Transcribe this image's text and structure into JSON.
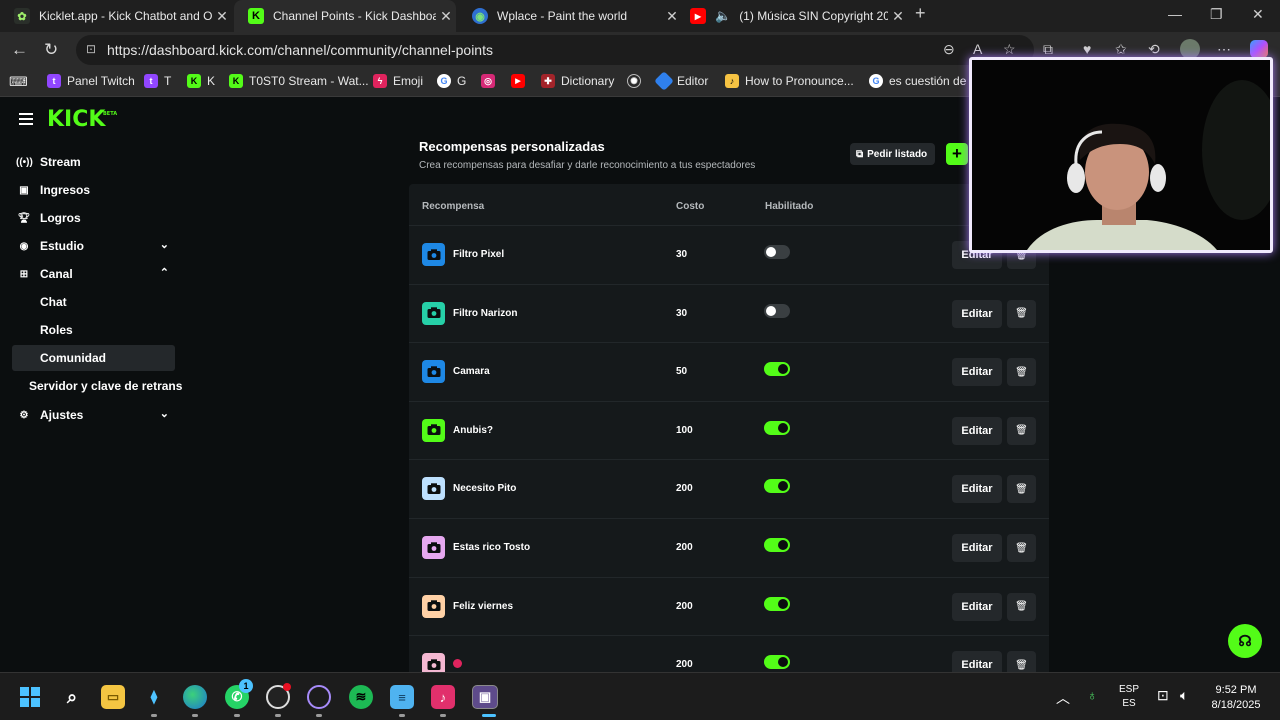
{
  "browser": {
    "tabs": [
      {
        "title": "Kicklet.app - Kick Chatbot and Ov",
        "favicon": "kicklet-icon",
        "active": false
      },
      {
        "title": "Channel Points - Kick Dashboard",
        "favicon": "kick-icon",
        "active": true
      },
      {
        "title": "Wplace - Paint the world",
        "favicon": "globe-icon",
        "active": false
      },
      {
        "title": "(1) Música SIN Copyright 20",
        "favicon": "youtube-icon",
        "active": false
      }
    ],
    "url": "https://dashboard.kick.com/channel/community/channel-points",
    "bookmarks": [
      {
        "label": "Panel Twitch",
        "icon": "twitch-icon"
      },
      {
        "label": "T",
        "icon": "twitch-icon"
      },
      {
        "label": "K",
        "icon": "kick-icon"
      },
      {
        "label": "T0ST0 Stream - Wat...",
        "icon": "kick-icon"
      },
      {
        "label": "Emoji",
        "icon": "emoji-icon"
      },
      {
        "label": "G",
        "icon": "google-icon"
      },
      {
        "label": "",
        "icon": "instagram-icon"
      },
      {
        "label": "",
        "icon": "youtube-icon"
      },
      {
        "label": "Dictionary",
        "icon": "dictionary-icon"
      },
      {
        "label": "",
        "icon": "chatgpt-icon"
      },
      {
        "label": "Editor",
        "icon": "editor-icon"
      },
      {
        "label": "How to Pronounce...",
        "icon": "pronounce-icon"
      },
      {
        "label": "es cuestión de t",
        "icon": "google-icon"
      }
    ]
  },
  "sidebar": {
    "logo": "KICK",
    "logo_badge": "BETA",
    "items": [
      {
        "label": "Stream",
        "icon": "stream-icon"
      },
      {
        "label": "Ingresos",
        "icon": "wallet-icon"
      },
      {
        "label": "Logros",
        "icon": "trophy-icon"
      },
      {
        "label": "Estudio",
        "icon": "studio-icon",
        "chevron": "down"
      },
      {
        "label": "Canal",
        "icon": "channel-icon",
        "chevron": "up"
      },
      {
        "label": "Chat"
      },
      {
        "label": "Roles"
      },
      {
        "label": "Comunidad",
        "active": true
      },
      {
        "label": "Servidor y clave de retrans"
      },
      {
        "label": "Ajustes",
        "icon": "gear-icon",
        "chevron": "down"
      }
    ]
  },
  "main": {
    "title": "Recompensas personalizadas",
    "subtitle": "Crea recompensas para desafiar y darle reconocimiento a tus espectadores",
    "request_button": "Pedir listado",
    "add_button": "+",
    "columns": {
      "reward": "Recompensa",
      "cost": "Costo",
      "enabled": "Habilitado"
    },
    "edit_label": "Editar",
    "rows": [
      {
        "name": "Filtro Pixel",
        "cost": "30",
        "enabled": false,
        "color": "#1e88e5"
      },
      {
        "name": "Filtro Narizon",
        "cost": "30",
        "enabled": false,
        "color": "#26d0a8"
      },
      {
        "name": "Camara",
        "cost": "50",
        "enabled": true,
        "color": "#1e88e5"
      },
      {
        "name": "Anubis?",
        "cost": "100",
        "enabled": true,
        "color": "#53fc18"
      },
      {
        "name": "Necesito Pito",
        "cost": "200",
        "enabled": true,
        "color": "#bde0fe"
      },
      {
        "name": "Estas rico Tosto",
        "cost": "200",
        "enabled": true,
        "color": "#e6a8f0"
      },
      {
        "name": "Feliz viernes",
        "cost": "200",
        "enabled": true,
        "color": "#ffd1a6"
      },
      {
        "name": "",
        "cost": "200",
        "enabled": true,
        "color": "#f4b8d2"
      }
    ]
  },
  "taskbar": {
    "apps": [
      "start-icon",
      "search-icon",
      "file-explorer-icon",
      "vs-code-icon",
      "edge-icon",
      "whatsapp-icon",
      "obs-icon",
      "app-icon",
      "spotify-icon",
      "notepad-icon",
      "tiktok-icon",
      "kick-studio-icon"
    ],
    "whatsapp_badge": "1",
    "lang_top": "ESP",
    "lang_bottom": "ES",
    "time": "9:52 PM",
    "date": "8/18/2025"
  },
  "colors": {
    "accent": "#53fc18",
    "background": "#0b0e0f",
    "card": "#15191b",
    "button": "#24282b"
  }
}
